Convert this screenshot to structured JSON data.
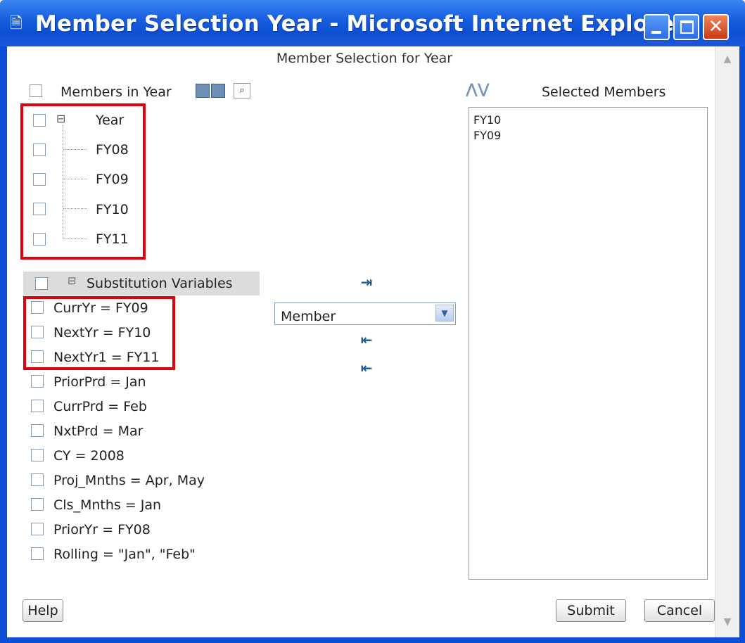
{
  "window": {
    "title": "Member Selection Year - Microsoft Internet Explorer",
    "icon": "ie-page-icon"
  },
  "frame_title": "Member Selection for Year",
  "left_panel": {
    "header_label": "Members in Year",
    "tree": [
      {
        "label": "Year",
        "expander": "⊟"
      },
      {
        "label": "FY08"
      },
      {
        "label": "FY09"
      },
      {
        "label": "FY10"
      },
      {
        "label": "FY11"
      }
    ],
    "subvars_header": "Substitution Variables",
    "subvars_expander": "⊟",
    "subvars": [
      "CurrYr = FY09",
      "NextYr = FY10",
      "NextYr1 = FY11",
      "PriorPrd = Jan",
      "CurrPrd = Feb",
      "NxtPrd = Mar",
      "CY = 2008",
      "Proj_Mnths = Apr, May",
      "Cls_Mnths = Jan",
      "PriorYr = FY08",
      "Rolling = \"Jan\", \"Feb\""
    ]
  },
  "middle": {
    "select_value": "Member"
  },
  "right_panel": {
    "header_label": "Selected Members",
    "items": [
      "FY10",
      "FY09"
    ]
  },
  "buttons": {
    "help": "Help",
    "submit": "Submit",
    "cancel": "Cancel"
  },
  "colors": {
    "highlight_red": "#e0000b",
    "titlebar_blue": "#0d4fd2"
  }
}
